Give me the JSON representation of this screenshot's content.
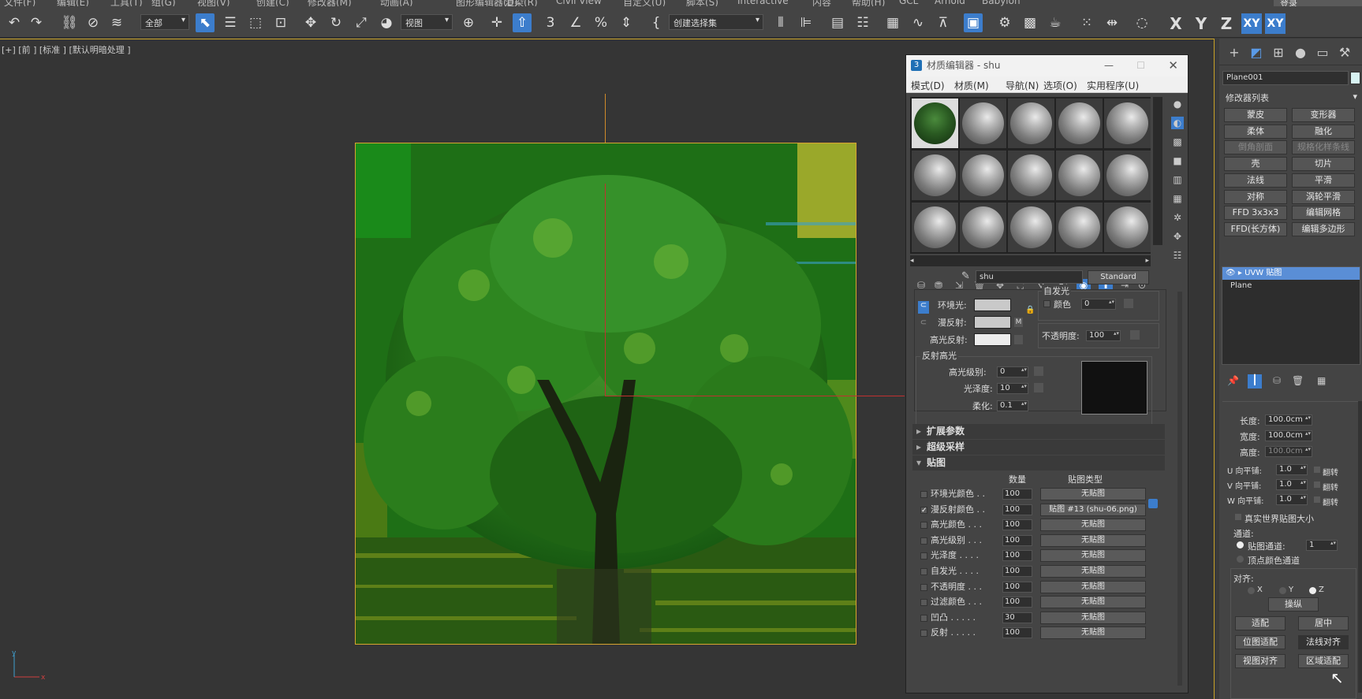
{
  "menubar": {
    "items": [
      "文件(F)",
      "编辑(E)",
      "工具(T)",
      "组(G)",
      "视图(V)",
      "创建(C)",
      "修改器(M)",
      "动画(A)",
      "图形编辑器(D)",
      "渲染(R)",
      "Civil View",
      "自定义(U)",
      "脚本(S)",
      "Interactive",
      "内容",
      "帮助(H)",
      "GCL",
      "Arnold",
      "Babylon"
    ]
  },
  "account": {
    "login": "登录"
  },
  "toolbar": {
    "filter": "全部",
    "coord": "视图",
    "selection_set": "创建选择集",
    "axes": [
      "X",
      "Y",
      "Z",
      "XY",
      "XY"
    ]
  },
  "viewport": {
    "label": "[+] [前 ] [标准 ] [默认明暗处理 ]",
    "gizmo_x": "x",
    "gizmo_y": "y"
  },
  "material_editor": {
    "title": "材质编辑器 - shu",
    "menu": [
      "模式(D)",
      "材质(M)",
      "导航(N)",
      "选项(O)",
      "实用程序(U)"
    ],
    "material_name": "shu",
    "material_type": "Standard",
    "basic": {
      "ambient": "环境光:",
      "diffuse": "漫反射:",
      "specular": "高光反射:",
      "m_btn": "M",
      "self_illum": "自发光",
      "color": "颜色",
      "self_illum_value": "0",
      "opacity": "不透明度:",
      "opacity_value": "100"
    },
    "highlights": {
      "title": "反射高光",
      "spec_level": "高光级别:",
      "spec_level_value": "0",
      "gloss": "光泽度:",
      "gloss_value": "10",
      "soften": "柔化:",
      "soften_value": "0.1"
    },
    "rollouts": [
      "扩展参数",
      "超级采样",
      "贴图"
    ],
    "maps_header": {
      "amount": "数量",
      "map_type": "贴图类型"
    },
    "maps": [
      {
        "label": "环境光颜色 . .",
        "amount": "100",
        "map": "无贴图",
        "checked": false
      },
      {
        "label": "漫反射颜色 . .",
        "amount": "100",
        "map": "贴图 #13 (shu-06.png)",
        "checked": true
      },
      {
        "label": "高光颜色 . . .",
        "amount": "100",
        "map": "无贴图",
        "checked": false
      },
      {
        "label": "高光级别 . . .",
        "amount": "100",
        "map": "无贴图",
        "checked": false
      },
      {
        "label": "光泽度 . . . .",
        "amount": "100",
        "map": "无贴图",
        "checked": false
      },
      {
        "label": "自发光 . . . .",
        "amount": "100",
        "map": "无贴图",
        "checked": false
      },
      {
        "label": "不透明度 . . .",
        "amount": "100",
        "map": "无贴图",
        "checked": false
      },
      {
        "label": "过滤颜色 . . .",
        "amount": "100",
        "map": "无贴图",
        "checked": false
      },
      {
        "label": "凹凸 . . . . .",
        "amount": "30",
        "map": "无贴图",
        "checked": false
      },
      {
        "label": "反射 . . . . .",
        "amount": "100",
        "map": "无贴图",
        "checked": false
      }
    ]
  },
  "command_panel": {
    "object_name": "Plane001",
    "modifier_list": "修改器列表",
    "buttons": [
      "蒙皮",
      "变形器",
      "柔体",
      "融化",
      "倒角剖面",
      "规格化样条线",
      "壳",
      "切片",
      "法线",
      "平滑",
      "对称",
      "涡轮平滑",
      "FFD 3x3x3",
      "编辑网格",
      "FFD(长方体)",
      "编辑多边形"
    ],
    "stack": [
      "UVW 贴图",
      "Plane"
    ],
    "params": {
      "length": "长度:",
      "length_val": "100.0cm",
      "width": "宽度:",
      "width_val": "100.0cm",
      "height": "高度:",
      "height_val": "100.0cm",
      "u_tile": "U 向平铺:",
      "v_tile": "V 向平铺:",
      "w_tile": "W 向平铺:",
      "tile_val": "1.0",
      "flip": "翻转",
      "real_world": "真实世界贴图大小",
      "channel": "通道:",
      "map_channel": "贴图通道:",
      "map_channel_val": "1",
      "vertex_color": "顶点颜色通道",
      "align": "对齐:",
      "x": "X",
      "y": "Y",
      "z": "Z",
      "manipulate": "操纵",
      "fit": "适配",
      "center": "居中",
      "bitmap_fit": "位图适配",
      "normal_align": "法线对齐",
      "view_align": "视图对齐",
      "region_fit": "区域适配"
    }
  }
}
